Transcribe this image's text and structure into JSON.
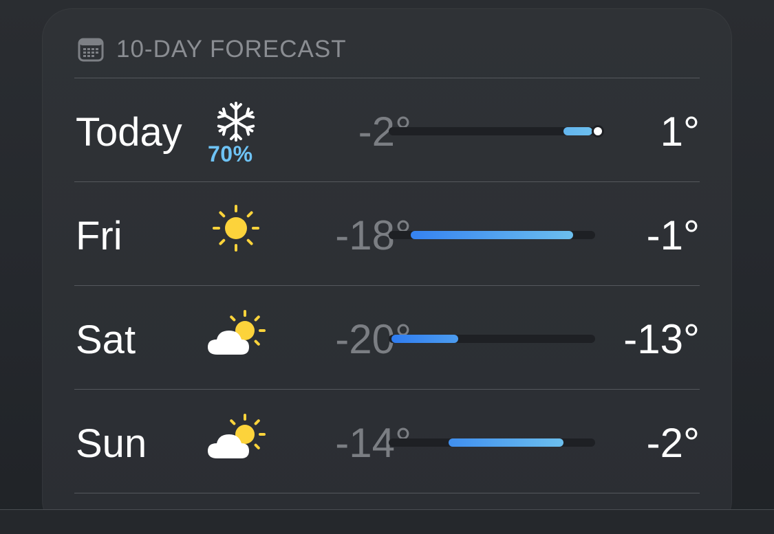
{
  "forecast": {
    "header": {
      "title": "10-DAY FORECAST",
      "icon": "calendar-icon"
    },
    "scale": {
      "min": -20,
      "max": 1
    },
    "colors": {
      "bar_cold": "#2f7cf0",
      "bar_cool": "#6cbfee",
      "precip_text": "#6ec3f5",
      "sun": "#fcd33b",
      "low_text": "#7b7e83"
    },
    "days": [
      {
        "label": "Today",
        "icon": "snowflake-icon",
        "precip": "70%",
        "low": "-2°",
        "high": "1°",
        "low_value": -2,
        "high_value": 1,
        "current_value": 1
      },
      {
        "label": "Fri",
        "icon": "sun-icon",
        "precip": "",
        "low": "-18°",
        "high": "-1°",
        "low_value": -18,
        "high_value": -1
      },
      {
        "label": "Sat",
        "icon": "partly-cloudy-icon",
        "precip": "",
        "low": "-20°",
        "high": "-13°",
        "low_value": -20,
        "high_value": -13
      },
      {
        "label": "Sun",
        "icon": "partly-cloudy-icon",
        "precip": "",
        "low": "-14°",
        "high": "-2°",
        "low_value": -14,
        "high_value": -2
      }
    ]
  }
}
